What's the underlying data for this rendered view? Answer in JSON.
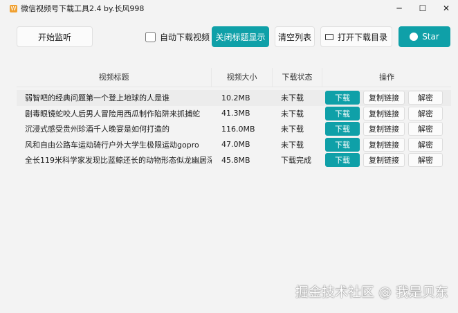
{
  "window": {
    "title": "微信视频号下载工具2.4 by.长风998",
    "icon": "app-icon",
    "minimize": "─",
    "maximize": "☐",
    "close": "✕"
  },
  "toolbar": {
    "start": "开始监听",
    "auto_download": "自动下载视频",
    "toggle_title": "关闭标题显示",
    "clear": "清空列表",
    "open_dir": "打开下载目录",
    "star": "Star"
  },
  "table": {
    "headers": [
      "视频标题",
      "视频大小",
      "下载状态",
      "操作"
    ],
    "rows": [
      {
        "title": "弱智吧的经典问题第一个登上地球的人是谁",
        "size": "10.2MB",
        "status": "未下载"
      },
      {
        "title": "剧毒眼镜蛇咬人后男人冒险用西瓜制作陷阱来抓捕蛇",
        "size": "41.3MB",
        "status": "未下载"
      },
      {
        "title": "沉浸式感受贵州珍酒千人晚宴是如何打造的",
        "size": "116.0MB",
        "status": "未下载"
      },
      {
        "title": "风和自由公路车运动骑行户外大学生极限运动gopro",
        "size": "47.0MB",
        "status": "未下载"
      },
      {
        "title": "全长119米科学家发现比蓝鲸还长的动物形态似龙幽居深...",
        "size": "45.8MB",
        "status": "下载完成"
      }
    ],
    "actions": {
      "download": "下载",
      "copy": "复制链接",
      "decrypt": "解密"
    }
  },
  "watermark": "掘金技术社区 @ 我是贝东",
  "colors": {
    "accent": "#0fa0a8"
  }
}
